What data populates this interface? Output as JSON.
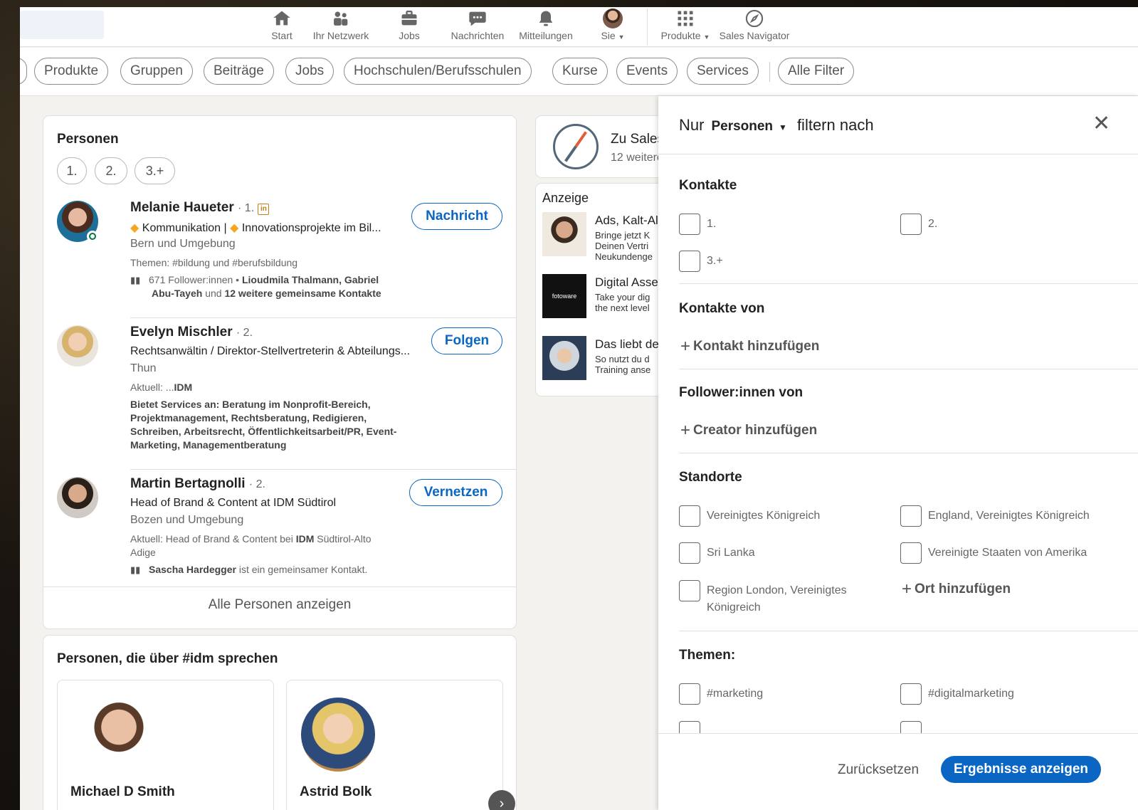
{
  "nav": {
    "items": [
      {
        "label": "Start",
        "icon": "home-icon"
      },
      {
        "label": "Ihr Netzwerk",
        "icon": "network-icon"
      },
      {
        "label": "Jobs",
        "icon": "briefcase-icon"
      },
      {
        "label": "Nachrichten",
        "icon": "messaging-icon"
      },
      {
        "label": "Mitteilungen",
        "icon": "bell-icon"
      },
      {
        "label": "Sie",
        "icon": "avatar"
      },
      {
        "label": "Produkte",
        "icon": "grid-icon"
      },
      {
        "label": "Sales Navigator",
        "icon": "compass-icon"
      }
    ]
  },
  "filters": {
    "chips": [
      "Produkte",
      "Gruppen",
      "Beiträge",
      "Jobs",
      "Hochschulen/Berufsschulen",
      "Kurse",
      "Events",
      "Services",
      "Alle Filter"
    ]
  },
  "people": {
    "title": "Personen",
    "degrees": [
      "1.",
      "2.",
      "3.+"
    ],
    "items": [
      {
        "name": "Melanie Haueter",
        "degree": "· 1.",
        "badge": "in",
        "headline_a": "Kommunikation |",
        "headline_b": "Innovationsprojekte im Bil...",
        "location": "Bern und Umgebung",
        "topics": "Themen: #bildung und #berufsbildung",
        "meta_1": "671 Follower:innen • ",
        "meta_1_bold": "Lioudmila Thalmann, Gabriel",
        "meta_2_bold_a": "Abu-Tayeh",
        "meta_2_mid": " und ",
        "meta_2_bold_b": "12 weitere gemeinsame Kontakte",
        "action": "Nachricht"
      },
      {
        "name": "Evelyn Mischler",
        "degree": "· 2.",
        "headline": "Rechtsanwältin / Direktor-Stellvertreterin & Abteilungs...",
        "location": "Thun",
        "current_prefix": "Aktuell: ...",
        "current_bold": "IDM",
        "services": [
          "Bietet Services an: Beratung im Nonprofit-Bereich,",
          "Projektmanagement, Rechtsberatung, Redigieren,",
          "Schreiben, Arbeitsrecht, Öffentlichkeitsarbeit/PR, Event-",
          "Marketing, Managementberatung"
        ],
        "action": "Folgen"
      },
      {
        "name": "Martin Bertagnolli",
        "degree": "· 2.",
        "headline": "Head of Brand & Content at IDM Südtirol",
        "location": "Bozen und Umgebung",
        "current_prefix": "Aktuell: Head of Brand & Content bei ",
        "current_bold": "IDM",
        "current_suffix": " Südtirol-Alto",
        "current_line2": "Adige",
        "mutual_bold": "Sascha Hardegger",
        "mutual_rest": " ist ein gemeinsamer Kontakt.",
        "action": "Vernetzen"
      }
    ],
    "show_all": "Alle Personen anzeigen"
  },
  "talking": {
    "title": "Personen, die über #idm sprechen",
    "people": [
      "Michael D Smith",
      "Astrid Bolk"
    ]
  },
  "sales": {
    "title": "Zu Sales",
    "subtitle": "12 weitere"
  },
  "ads": {
    "label": "Anzeige",
    "items": [
      {
        "title": "Ads, Kalt-Al",
        "lines": [
          "Bringe jetzt K",
          "Deinen Vertri",
          "Neukundenge"
        ]
      },
      {
        "title": "Digital Asse",
        "lines": [
          "Take your dig",
          "the next level"
        ],
        "logo": "fotoware"
      },
      {
        "title": "Das liebt de",
        "lines": [
          "So nutzt du d",
          "Training anse"
        ]
      }
    ]
  },
  "panel": {
    "prefix": "Nur",
    "select": "Personen",
    "suffix": "filtern nach",
    "sections": {
      "kontakte": {
        "title": "Kontakte",
        "options": [
          "1.",
          "2.",
          "3.+"
        ]
      },
      "kontakte_von": {
        "title": "Kontakte von",
        "add": "Kontakt hinzufügen"
      },
      "follower": {
        "title": "Follower:innen von",
        "add": "Creator hinzufügen"
      },
      "standorte": {
        "title": "Standorte",
        "options": [
          "Vereinigtes Königreich",
          "England, Vereinigtes Königreich",
          "Sri Lanka",
          "Vereinigte Staaten von Amerika",
          "Region London, Vereinigtes",
          "Königreich"
        ],
        "add": "Ort hinzufügen"
      },
      "themen": {
        "title": "Themen:",
        "options": [
          "#marketing",
          "#digitalmarketing"
        ]
      }
    },
    "reset": "Zurücksetzen",
    "apply": "Ergebnisse anzeigen"
  }
}
